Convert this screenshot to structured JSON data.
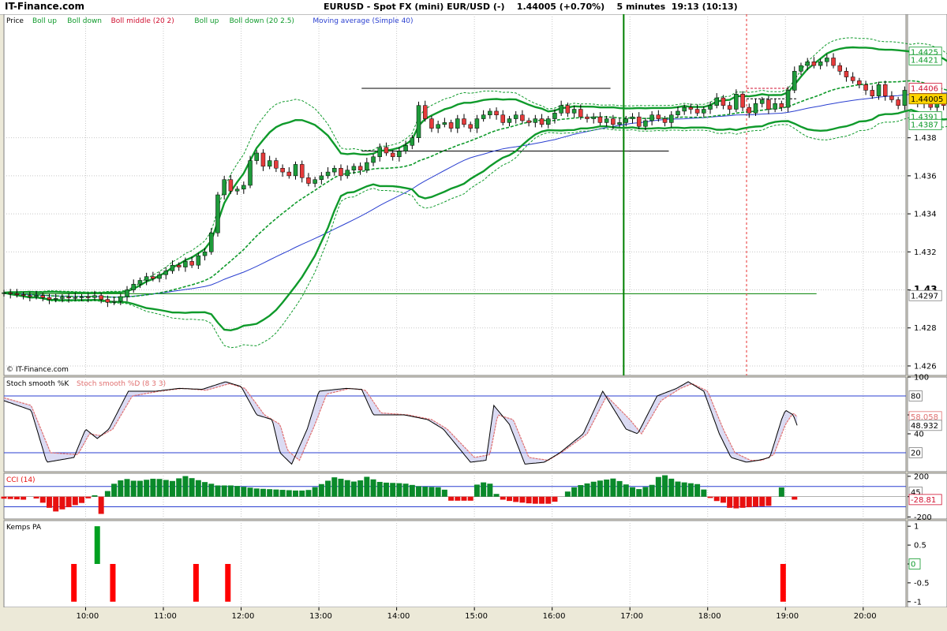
{
  "window": {
    "brand": "IT-Finance.com",
    "title": "EURUSD - Spot FX (mini) EUR/USD (-)    1.44005 (+0.70%)    5 minutes  19:13 (10:13)"
  },
  "colors": {
    "bull": "#1e9b3a",
    "bear": "#e63b3b",
    "boll": "#0f9a2b",
    "ma": "#2a3fd0",
    "stochK": "#000000",
    "stochD": "#e07070",
    "cciPos": "#0a8a2a",
    "cciNeg": "#e81010",
    "price_label_bg": "#ffd400"
  },
  "chart_data": [
    {
      "type": "candlestick",
      "panel": "price",
      "legend": [
        {
          "text": "Price",
          "color": "#000000"
        },
        {
          "text": "Boll up",
          "color": "#0f9a2b"
        },
        {
          "text": "Boll down",
          "color": "#0f9a2b"
        },
        {
          "text": "Boll middle (20 2)",
          "color": "#d01030"
        },
        {
          "text": "Boll up",
          "color": "#0f9a2b"
        },
        {
          "text": "Boll down (20 2.5)",
          "color": "#0f9a2b"
        },
        {
          "text": "Moving average (Simple 40)",
          "color": "#2a3fd0"
        }
      ],
      "credit": "© IT-Finance.com",
      "ylim": [
        1.4255,
        1.4445
      ],
      "y_ticks": [
        1.426,
        1.428,
        1.43,
        1.432,
        1.434,
        1.436,
        1.438
      ],
      "y_tick_labels": [
        "1.426",
        "1.428",
        "1.43",
        "1.432",
        "1.434",
        "1.436",
        "1.438"
      ],
      "value_labels": [
        {
          "value": 1.4425,
          "text": "1.4425",
          "style": "green"
        },
        {
          "value": 1.4421,
          "text": "1.4421",
          "style": "green"
        },
        {
          "value": 1.4406,
          "text": "1.4406",
          "style": "red"
        },
        {
          "value": 1.44005,
          "text": "1.44005",
          "style": "current"
        },
        {
          "value": 1.4391,
          "text": "1.4391",
          "style": "green"
        },
        {
          "value": 1.4387,
          "text": "1.4387",
          "style": "green"
        },
        {
          "value": 1.4297,
          "text": "1.4297",
          "style": "plain"
        }
      ],
      "x": [
        "10:00",
        "11:00",
        "12:00",
        "13:00",
        "14:00",
        "15:00",
        "16:00",
        "17:00",
        "18:00",
        "19:00",
        "20:00"
      ],
      "x_tick_times": [
        10,
        11,
        12,
        13,
        14,
        15,
        16,
        17,
        18,
        19,
        20
      ],
      "time_start": 8.95,
      "bar_minutes": 5,
      "closes": [
        1.42985,
        1.4298,
        1.42975,
        1.4297,
        1.42965,
        1.4297,
        1.4296,
        1.4295,
        1.42955,
        1.42962,
        1.42958,
        1.4296,
        1.42963,
        1.4296,
        1.4297,
        1.4295,
        1.42935,
        1.4294,
        1.42965,
        1.43,
        1.4303,
        1.4305,
        1.4307,
        1.4306,
        1.4308,
        1.431,
        1.4313,
        1.4312,
        1.4315,
        1.4313,
        1.4318,
        1.432,
        1.433,
        1.435,
        1.4358,
        1.4352,
        1.4353,
        1.4355,
        1.4368,
        1.4372,
        1.4365,
        1.4368,
        1.4364,
        1.4362,
        1.436,
        1.4366,
        1.4359,
        1.4356,
        1.4358,
        1.436,
        1.4362,
        1.4364,
        1.436,
        1.4363,
        1.4365,
        1.4363,
        1.4367,
        1.437,
        1.4375,
        1.4372,
        1.437,
        1.4373,
        1.4376,
        1.438,
        1.4397,
        1.439,
        1.4385,
        1.4387,
        1.4388,
        1.4385,
        1.439,
        1.4387,
        1.4385,
        1.439,
        1.4392,
        1.4394,
        1.4392,
        1.4388,
        1.439,
        1.4392,
        1.4389,
        1.4388,
        1.439,
        1.4387,
        1.439,
        1.4393,
        1.4397,
        1.4393,
        1.4395,
        1.4391,
        1.439,
        1.4391,
        1.4388,
        1.439,
        1.4387,
        1.4388,
        1.439,
        1.4391,
        1.4386,
        1.4389,
        1.4392,
        1.439,
        1.4388,
        1.4392,
        1.4394,
        1.4396,
        1.4395,
        1.4393,
        1.4395,
        1.4397,
        1.4401,
        1.4397,
        1.4395,
        1.4403,
        1.4396,
        1.4393,
        1.4398,
        1.44,
        1.4395,
        1.4398,
        1.4396,
        1.4405,
        1.4415,
        1.4418,
        1.442,
        1.4418,
        1.442,
        1.4422,
        1.4418,
        1.4415,
        1.4412,
        1.441,
        1.4408,
        1.4405,
        1.4402,
        1.4408,
        1.4402,
        1.44,
        1.4397,
        1.4405,
        1.44,
        1.4398,
        1.4399,
        1.4396,
        1.4398,
        1.4397,
        1.44,
        1.4406,
        1.4398,
        1.44005
      ],
      "horizontal_lines": [
        {
          "value": 1.4298,
          "t_start": 8.95,
          "t_end": 19.4,
          "color": "#008000",
          "dash": false
        },
        {
          "value": 1.4406,
          "t_start": 18.5,
          "t_end": 19.15,
          "color": "#d01030",
          "dash": true
        },
        {
          "value": 1.44005,
          "t_start": 18.5,
          "t_end": 19.15,
          "color": "#000000",
          "dash": true
        },
        {
          "value": 1.4406,
          "t_start": 13.55,
          "t_end": 16.75,
          "color": "#000000",
          "dash": false
        },
        {
          "value": 1.4373,
          "t_start": 13.55,
          "t_end": 17.5,
          "color": "#000000",
          "dash": false
        }
      ],
      "vertical_lines": [
        {
          "t": 16.92,
          "color": "#008000",
          "dash": false,
          "width": 2
        },
        {
          "t": 18.5,
          "color": "#e83030",
          "dash": true,
          "width": 1
        }
      ]
    },
    {
      "type": "line",
      "panel": "stochastic",
      "legend": [
        {
          "text": "Stoch smooth %K",
          "color": "#000000"
        },
        {
          "text": "Stoch smooth %D (8 3 3)",
          "color": "#e07070"
        }
      ],
      "ylim": [
        0,
        100
      ],
      "y_ticks": [
        40,
        60,
        100
      ],
      "y_tick_labels": [
        "40",
        "60",
        "100"
      ],
      "levels": [
        20,
        80
      ],
      "level_labels": [
        "20",
        "80"
      ],
      "value_labels": [
        {
          "value": 58.058,
          "text": "58.058",
          "style": "pink"
        },
        {
          "value": 48.932,
          "text": "48.932",
          "style": "plain"
        }
      ],
      "k_knots": [
        [
          8.95,
          75
        ],
        [
          9.3,
          65
        ],
        [
          9.5,
          10
        ],
        [
          9.85,
          15
        ],
        [
          10.0,
          45
        ],
        [
          10.15,
          35
        ],
        [
          10.3,
          45
        ],
        [
          10.55,
          85
        ],
        [
          10.9,
          85
        ],
        [
          11.2,
          88
        ],
        [
          11.5,
          87
        ],
        [
          11.8,
          95
        ],
        [
          12.0,
          90
        ],
        [
          12.2,
          60
        ],
        [
          12.4,
          55
        ],
        [
          12.5,
          20
        ],
        [
          12.65,
          8
        ],
        [
          12.85,
          45
        ],
        [
          13.0,
          85
        ],
        [
          13.35,
          88
        ],
        [
          13.55,
          87
        ],
        [
          13.7,
          60
        ],
        [
          14.1,
          60
        ],
        [
          14.4,
          55
        ],
        [
          14.6,
          45
        ],
        [
          14.95,
          10
        ],
        [
          15.15,
          12
        ],
        [
          15.25,
          70
        ],
        [
          15.45,
          50
        ],
        [
          15.65,
          8
        ],
        [
          15.9,
          10
        ],
        [
          16.1,
          20
        ],
        [
          16.4,
          40
        ],
        [
          16.65,
          85
        ],
        [
          16.95,
          45
        ],
        [
          17.1,
          40
        ],
        [
          17.35,
          80
        ],
        [
          17.6,
          88
        ],
        [
          17.75,
          95
        ],
        [
          17.95,
          85
        ],
        [
          18.15,
          40
        ],
        [
          18.3,
          15
        ],
        [
          18.5,
          10
        ],
        [
          18.65,
          12
        ],
        [
          18.8,
          15
        ],
        [
          18.95,
          55
        ],
        [
          19.0,
          65
        ],
        [
          19.1,
          60
        ],
        [
          19.15,
          48.932
        ]
      ],
      "d_knots": [
        [
          8.95,
          78
        ],
        [
          9.3,
          70
        ],
        [
          9.55,
          20
        ],
        [
          9.9,
          18
        ],
        [
          10.05,
          40
        ],
        [
          10.2,
          38
        ],
        [
          10.35,
          45
        ],
        [
          10.6,
          80
        ],
        [
          10.95,
          85
        ],
        [
          11.25,
          88
        ],
        [
          11.55,
          86
        ],
        [
          11.85,
          93
        ],
        [
          12.05,
          88
        ],
        [
          12.3,
          60
        ],
        [
          12.5,
          50
        ],
        [
          12.6,
          22
        ],
        [
          12.75,
          12
        ],
        [
          12.95,
          50
        ],
        [
          13.1,
          82
        ],
        [
          13.4,
          88
        ],
        [
          13.6,
          86
        ],
        [
          13.8,
          62
        ],
        [
          14.15,
          60
        ],
        [
          14.45,
          55
        ],
        [
          14.65,
          45
        ],
        [
          15.0,
          15
        ],
        [
          15.2,
          18
        ],
        [
          15.3,
          60
        ],
        [
          15.5,
          55
        ],
        [
          15.7,
          15
        ],
        [
          15.95,
          12
        ],
        [
          16.15,
          22
        ],
        [
          16.45,
          40
        ],
        [
          16.7,
          80
        ],
        [
          17.0,
          55
        ],
        [
          17.15,
          40
        ],
        [
          17.4,
          75
        ],
        [
          17.65,
          88
        ],
        [
          17.8,
          93
        ],
        [
          18.0,
          85
        ],
        [
          18.2,
          45
        ],
        [
          18.35,
          20
        ],
        [
          18.55,
          12
        ],
        [
          18.7,
          12
        ],
        [
          18.85,
          18
        ],
        [
          19.0,
          50
        ],
        [
          19.1,
          62
        ],
        [
          19.15,
          58.058
        ]
      ]
    },
    {
      "type": "bar",
      "panel": "cci",
      "legend": [
        {
          "text": "CCI (14)",
          "color": "#e81010"
        }
      ],
      "ylim": [
        -220,
        230
      ],
      "y_ticks": [
        -200,
        0,
        200
      ],
      "y_tick_labels": [
        "-200",
        "0",
        "200"
      ],
      "levels": [
        -100,
        100
      ],
      "value_labels": [
        {
          "value": 45,
          "text": "45",
          "style": "plain"
        },
        {
          "value": -28.81,
          "text": "-28.81",
          "style": "red"
        }
      ],
      "knots": [
        [
          8.95,
          -20
        ],
        [
          9.2,
          -30
        ],
        [
          9.3,
          15
        ],
        [
          9.45,
          -60
        ],
        [
          9.6,
          -150
        ],
        [
          9.8,
          -100
        ],
        [
          10.0,
          -50
        ],
        [
          10.1,
          50
        ],
        [
          10.2,
          -170
        ],
        [
          10.3,
          100
        ],
        [
          10.5,
          180
        ],
        [
          10.65,
          150
        ],
        [
          10.9,
          180
        ],
        [
          11.15,
          150
        ],
        [
          11.25,
          210
        ],
        [
          11.5,
          150
        ],
        [
          11.7,
          110
        ],
        [
          11.9,
          110
        ],
        [
          12.2,
          80
        ],
        [
          12.45,
          70
        ],
        [
          12.7,
          60
        ],
        [
          12.85,
          60
        ],
        [
          13.0,
          110
        ],
        [
          13.2,
          190
        ],
        [
          13.5,
          140
        ],
        [
          13.6,
          200
        ],
        [
          13.8,
          140
        ],
        [
          14.1,
          130
        ],
        [
          14.3,
          100
        ],
        [
          14.6,
          90
        ],
        [
          14.7,
          -40
        ],
        [
          14.95,
          -40
        ],
        [
          15.05,
          150
        ],
        [
          15.25,
          120
        ],
        [
          15.3,
          -20
        ],
        [
          15.5,
          -50
        ],
        [
          15.75,
          -70
        ],
        [
          16.0,
          -70
        ],
        [
          16.2,
          50
        ],
        [
          16.3,
          100
        ],
        [
          16.55,
          150
        ],
        [
          16.8,
          180
        ],
        [
          16.95,
          120
        ],
        [
          17.1,
          70
        ],
        [
          17.3,
          120
        ],
        [
          17.4,
          230
        ],
        [
          17.6,
          150
        ],
        [
          17.9,
          120
        ],
        [
          18.05,
          -30
        ],
        [
          18.2,
          -60
        ],
        [
          18.3,
          -120
        ],
        [
          18.6,
          -100
        ],
        [
          18.8,
          -90
        ],
        [
          18.95,
          90
        ],
        [
          19.05,
          -30
        ],
        [
          19.15,
          -28.81
        ]
      ]
    },
    {
      "type": "bar",
      "panel": "kemps",
      "legend": [
        {
          "text": "Kemps PA",
          "color": "#000000"
        }
      ],
      "ylim": [
        -1.15,
        1.15
      ],
      "y_ticks": [
        -1,
        -0.5,
        0,
        0.5,
        1
      ],
      "y_tick_labels": [
        "-1",
        "-0.5",
        "",
        "0.5",
        "1"
      ],
      "value_labels": [
        {
          "value": 0,
          "text": "0",
          "style": "plainGreen"
        }
      ],
      "bars": [
        [
          9.85,
          -1
        ],
        [
          10.15,
          1
        ],
        [
          10.35,
          -1
        ],
        [
          11.42,
          -1
        ],
        [
          11.83,
          -1
        ],
        [
          18.97,
          -1
        ]
      ]
    }
  ]
}
